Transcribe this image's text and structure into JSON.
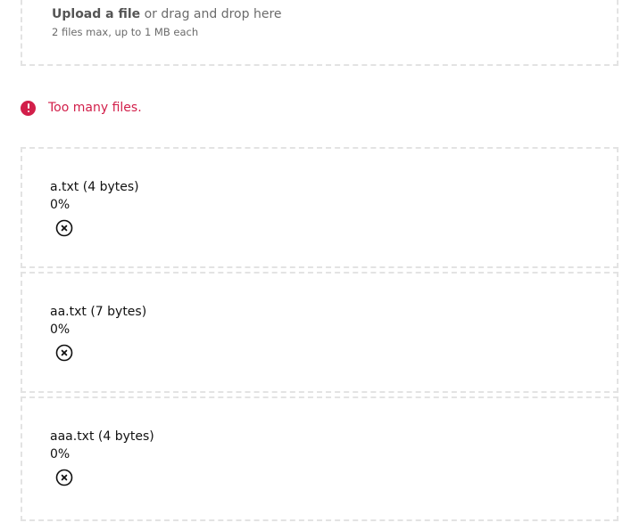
{
  "dropzone": {
    "upload_link": "Upload a file",
    "drag_text": " or drag and drop here",
    "constraints": "2 files max, up to 1 MB each"
  },
  "error": {
    "icon": "alert-circle-icon",
    "message": "Too many files."
  },
  "files": [
    {
      "label": "a.txt (4 bytes)",
      "progress": "0%",
      "remove_icon": "close-circle-icon"
    },
    {
      "label": "aa.txt (7 bytes)",
      "progress": "0%",
      "remove_icon": "close-circle-icon"
    },
    {
      "label": "aaa.txt (4 bytes)",
      "progress": "0%",
      "remove_icon": "close-circle-icon"
    }
  ],
  "colors": {
    "error": "#d21f4a",
    "border": "#e3e3e3",
    "muted_text": "#6b6b6b"
  }
}
